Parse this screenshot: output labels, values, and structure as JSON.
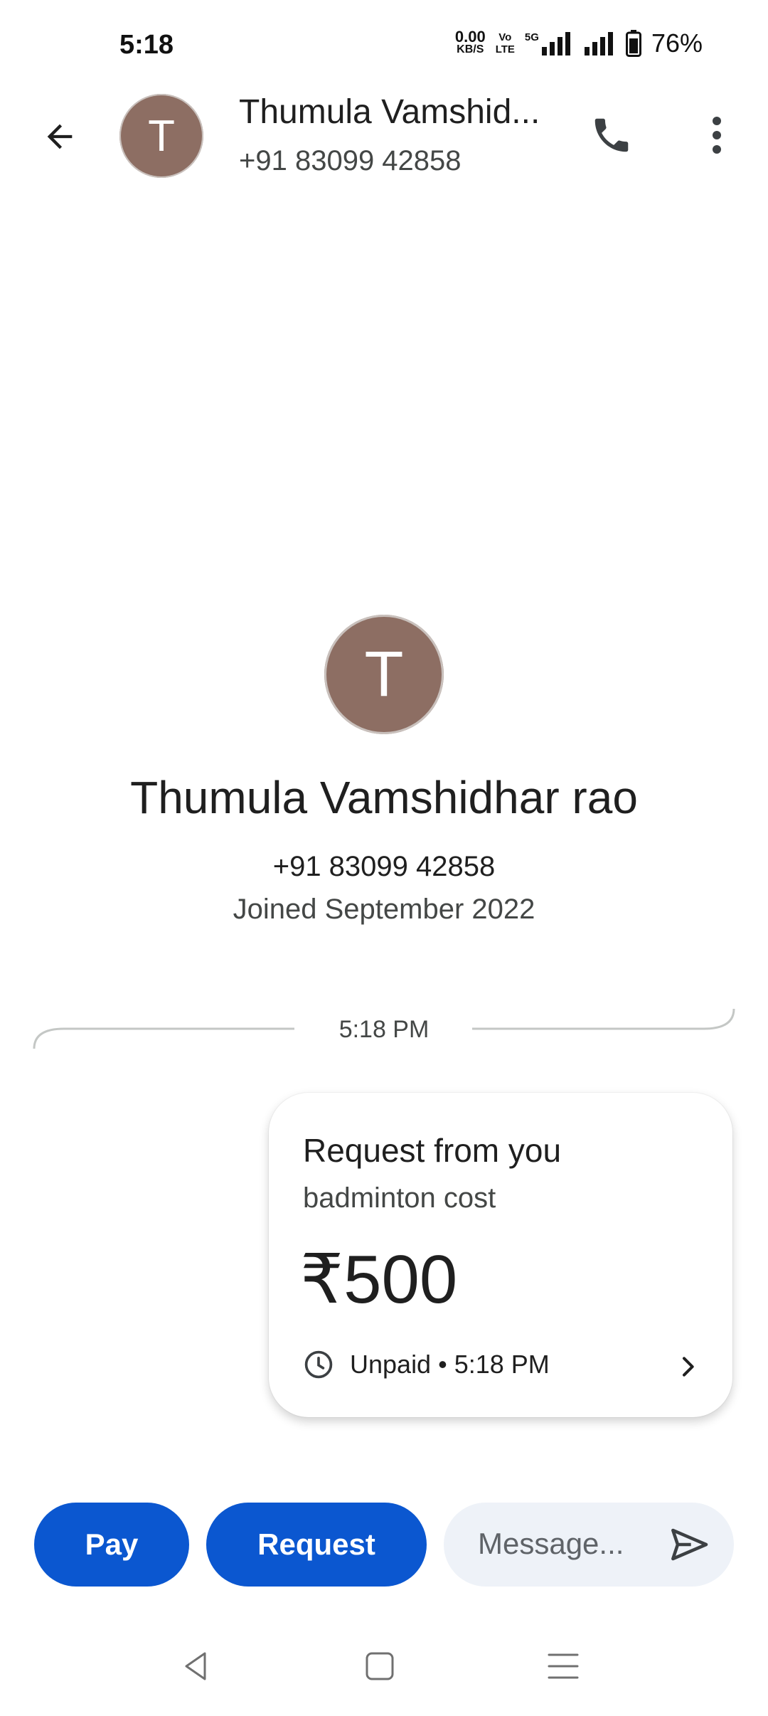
{
  "status_bar": {
    "time": "5:18",
    "net_speed_value": "0.00",
    "net_speed_unit": "KB/S",
    "volte_top": "Vo",
    "volte_bottom": "LTE",
    "network": "5G",
    "battery_percent": "76%"
  },
  "header": {
    "avatar_initial": "T",
    "contact_name": "Thumula Vamshid...",
    "contact_phone": "+91 83099 42858"
  },
  "profile": {
    "avatar_initial": "T",
    "name": "Thumula Vamshidhar rao",
    "phone": "+91 83099 42858",
    "joined": "Joined September 2022"
  },
  "timeline": {
    "time": "5:18 PM"
  },
  "request_card": {
    "title": "Request from you",
    "note": "badminton cost",
    "amount": "₹500",
    "status": "Unpaid • 5:18 PM"
  },
  "actions": {
    "pay_label": "Pay",
    "request_label": "Request",
    "message_placeholder": "Message..."
  },
  "colors": {
    "accent": "#0b57d0",
    "avatar": "#8d6e63",
    "message_box": "#eef2f8"
  },
  "icons": {
    "back": "arrow-left-icon",
    "call": "phone-icon",
    "more": "more-vert-icon",
    "clock": "clock-icon",
    "chevron": "chevron-right-icon",
    "send": "send-icon"
  }
}
